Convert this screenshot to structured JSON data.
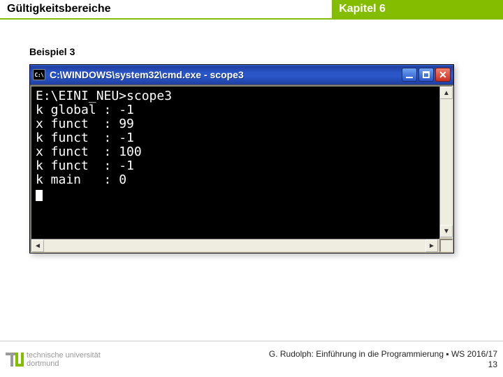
{
  "header": {
    "left": "Gültigkeitsbereiche",
    "right": "Kapitel 6"
  },
  "subtitle": "Beispiel 3",
  "cmd": {
    "sys_icon_text": "C:\\",
    "title": "C:\\WINDOWS\\system32\\cmd.exe - scope3",
    "buttons": {
      "minimize": "minimize",
      "maximize": "maximize",
      "close": "close"
    },
    "lines": [
      "E:\\EINI_NEU>scope3",
      "k global : -1",
      "x funct  : 99",
      "k funct  : -1",
      "x funct  : 100",
      "k funct  : -1",
      "k main   : 0"
    ]
  },
  "footer": {
    "uni_line1": "technische universität",
    "uni_line2": "dortmund",
    "credit": "G. Rudolph: Einführung in die Programmierung ▪ WS 2016/17",
    "page": "13"
  }
}
